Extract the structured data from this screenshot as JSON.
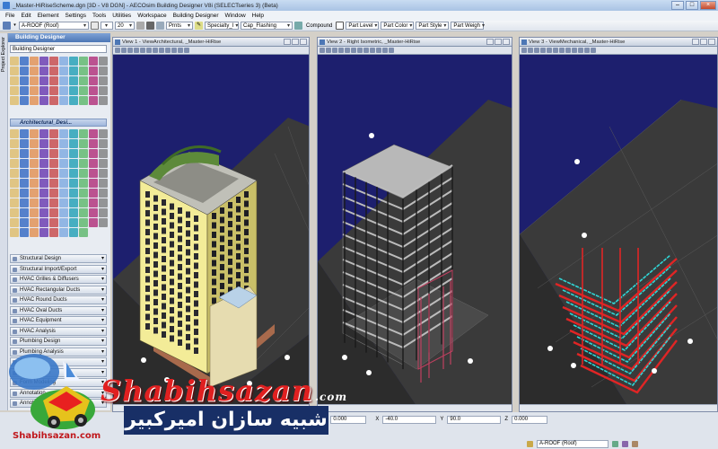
{
  "window": {
    "title": "_Master-HiRiseScheme.dgn [3D - V8 DGN] - AECOsim Building Designer V8i (SELECTseries 3) (Beta)"
  },
  "menu": [
    "File",
    "Edit",
    "Element",
    "Settings",
    "Tools",
    "Utilities",
    "Workspace",
    "Building Designer",
    "Window",
    "Help"
  ],
  "toolbar2": {
    "level_value": "20",
    "print_label": "Prnts",
    "specialty_label": "Specialty_I",
    "flashing_label": "Cap_Flashing",
    "compound_label": "Compound",
    "part_level": "Part Level",
    "part_color": "Part Color",
    "part_style": "Part Style",
    "part_weight": "Part Weigh"
  },
  "toolbar3": {
    "active_family": "A-ROOF (Roof)"
  },
  "panel": {
    "title": "Building Designer",
    "dropdown": "Building Designer",
    "tabs": [
      "Project Explorer"
    ],
    "section": "Architectural_Desi...",
    "ddl_label": "DP4B",
    "categories": [
      "Structural Design",
      "Structural Import/Export",
      "HVAC Grilles & Diffusers",
      "HVAC Rectangular Ducts",
      "HVAC Round Ducts",
      "HVAC Oval Ducts",
      "HVAC Equipment",
      "HVAC Analysis",
      "Plumbing Design",
      "Plumbing Analysis",
      "Data",
      "Coordination",
      "Form Modeling",
      "Annotation",
      "Annotation"
    ]
  },
  "views": [
    {
      "title": "View 1 - ViewArchitectural, _Master-HiRise"
    },
    {
      "title": "View 2 - Right Isometric, _Master-HiRise"
    },
    {
      "title": "View 3 - ViewMechanical, _Master-HiRise"
    }
  ],
  "status": {
    "message": "ViewMechanical saved view applied",
    "rotation_label": "Floor (ACS) Rotation:",
    "rotation_value": "0.000",
    "x_label": "X",
    "x_value": "-40.0",
    "y_label": "Y",
    "y_value": "90.0",
    "z_label": "Z",
    "z_value": "0.000",
    "active_level": "A-ROOF (Roof)"
  },
  "watermark": {
    "latin": "Shabihsazan",
    "dotcom": ".com",
    "persian": "شبیه سازان امیرکبیر",
    "url": "Shabihsazan.com"
  },
  "colors": {
    "view_bg": "#1d1f6e",
    "ground": "#3c3c3c",
    "facade": "#f3ec98",
    "pipe_red": "#e02525",
    "pipe_cyan": "#2fd6d6"
  }
}
